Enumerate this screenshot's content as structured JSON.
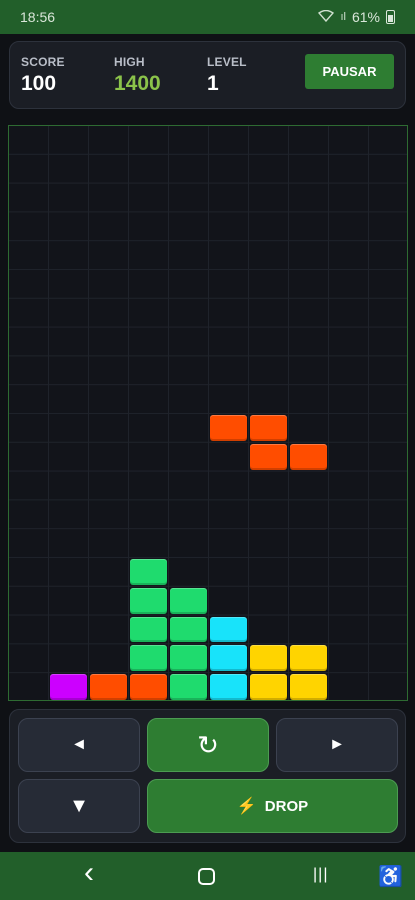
{
  "status": {
    "time": "18:56",
    "signal": "ıl",
    "battery": "61%"
  },
  "header": {
    "score_label": "SCORE",
    "score": "100",
    "high_label": "HIGH",
    "high": "1400",
    "level_label": "LEVEL",
    "level": "1",
    "pause_label": "PAUSAR"
  },
  "board": {
    "columns": 10,
    "rows": 20,
    "colors": {
      "purple": "#cc00ff",
      "orange": "#ff4d00",
      "green": "#1fdb6e",
      "cyan": "#18e3fa",
      "yellow": "#ffd400"
    },
    "active_piece": {
      "type": "Z",
      "color": "orange",
      "cells": [
        [
          5,
          10
        ],
        [
          6,
          10
        ],
        [
          6,
          11
        ],
        [
          7,
          11
        ]
      ]
    },
    "locked_cells": [
      {
        "col": 3,
        "row": 15,
        "color": "green"
      },
      {
        "col": 3,
        "row": 16,
        "color": "green"
      },
      {
        "col": 4,
        "row": 16,
        "color": "green"
      },
      {
        "col": 3,
        "row": 17,
        "color": "green"
      },
      {
        "col": 4,
        "row": 17,
        "color": "green"
      },
      {
        "col": 5,
        "row": 17,
        "color": "cyan"
      },
      {
        "col": 3,
        "row": 18,
        "color": "green"
      },
      {
        "col": 4,
        "row": 18,
        "color": "green"
      },
      {
        "col": 5,
        "row": 18,
        "color": "cyan"
      },
      {
        "col": 6,
        "row": 18,
        "color": "yellow"
      },
      {
        "col": 7,
        "row": 18,
        "color": "yellow"
      },
      {
        "col": 1,
        "row": 19,
        "color": "purple"
      },
      {
        "col": 2,
        "row": 19,
        "color": "orange"
      },
      {
        "col": 3,
        "row": 19,
        "color": "orange"
      },
      {
        "col": 4,
        "row": 19,
        "color": "green"
      },
      {
        "col": 5,
        "row": 19,
        "color": "cyan"
      },
      {
        "col": 6,
        "row": 19,
        "color": "yellow"
      },
      {
        "col": 7,
        "row": 19,
        "color": "yellow"
      }
    ]
  },
  "controls": {
    "left_icon": "left-triangle-icon",
    "left_glyph": "◄",
    "rotate_icon": "rotate-icon",
    "rotate_glyph": "↻",
    "right_icon": "right-triangle-icon",
    "right_glyph": "►",
    "down_icon": "down-triangle-icon",
    "down_glyph": "▼",
    "drop_icon": "lightning-icon",
    "drop_glyph": "⚡",
    "drop_label": "DROP"
  },
  "navbar": {
    "back_glyph": "‹",
    "recents_glyph": "|||",
    "accessibility_glyph": "♿"
  }
}
